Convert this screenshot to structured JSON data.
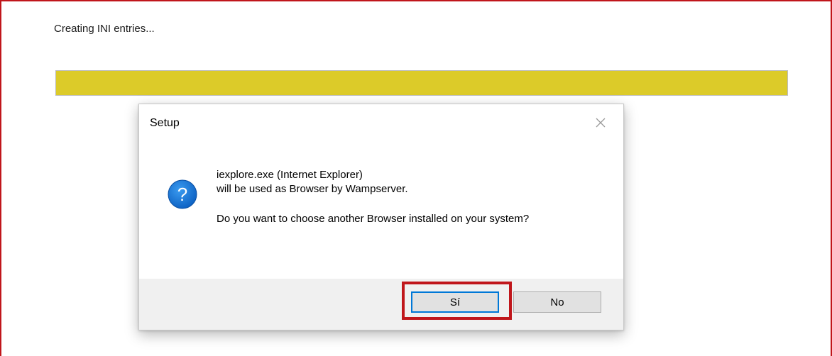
{
  "installer": {
    "status_text": "Creating INI entries...",
    "progress_fraction": 1.0,
    "progress_color": "#dccb29"
  },
  "dialog": {
    "title": "Setup",
    "close_icon": "close-icon",
    "message_icon": "question-icon",
    "message_line_1": "iexplore.exe (Internet Explorer)",
    "message_line_2": "will be used as Browser by Wampserver.",
    "message_line_3": "Do you want to choose another Browser installed on your system?",
    "buttons": {
      "yes_label": "Sí",
      "no_label": "No"
    }
  },
  "annotation": {
    "highlight_color": "#c0161b",
    "highlighted_target": "yes-button"
  }
}
